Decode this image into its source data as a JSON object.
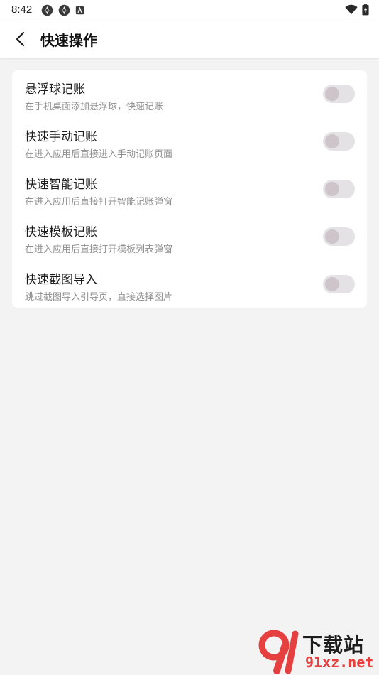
{
  "status_bar": {
    "time": "8:42",
    "icons_left": [
      "aperture-icon",
      "aperture-icon",
      "a-notification-icon"
    ],
    "icons_right": [
      "wifi-icon",
      "battery-charging-icon"
    ]
  },
  "app_bar": {
    "back_icon": "chevron-left-icon",
    "title": "快速操作"
  },
  "settings": [
    {
      "title": "悬浮球记账",
      "description": "在手机桌面添加悬浮球，快速记账",
      "enabled": false
    },
    {
      "title": "快速手动记账",
      "description": "在进入应用后直接进入手动记账页面",
      "enabled": false
    },
    {
      "title": "快速智能记账",
      "description": "在进入应用后直接打开智能记账弹窗",
      "enabled": false
    },
    {
      "title": "快速模板记账",
      "description": "在进入应用后直接打开模板列表弹窗",
      "enabled": false
    },
    {
      "title": "快速截图导入",
      "description": "跳过截图导入引导页，直接选择图片",
      "enabled": false
    }
  ],
  "watermark": {
    "title": "下载站",
    "domain": "91xz.net"
  },
  "colors": {
    "background": "#f4f3f4",
    "card": "#ffffff",
    "toggle_track_off": "#e4e2e4",
    "toggle_knob_off": "#cdc5c9",
    "watermark_red": "#e63f3f"
  }
}
